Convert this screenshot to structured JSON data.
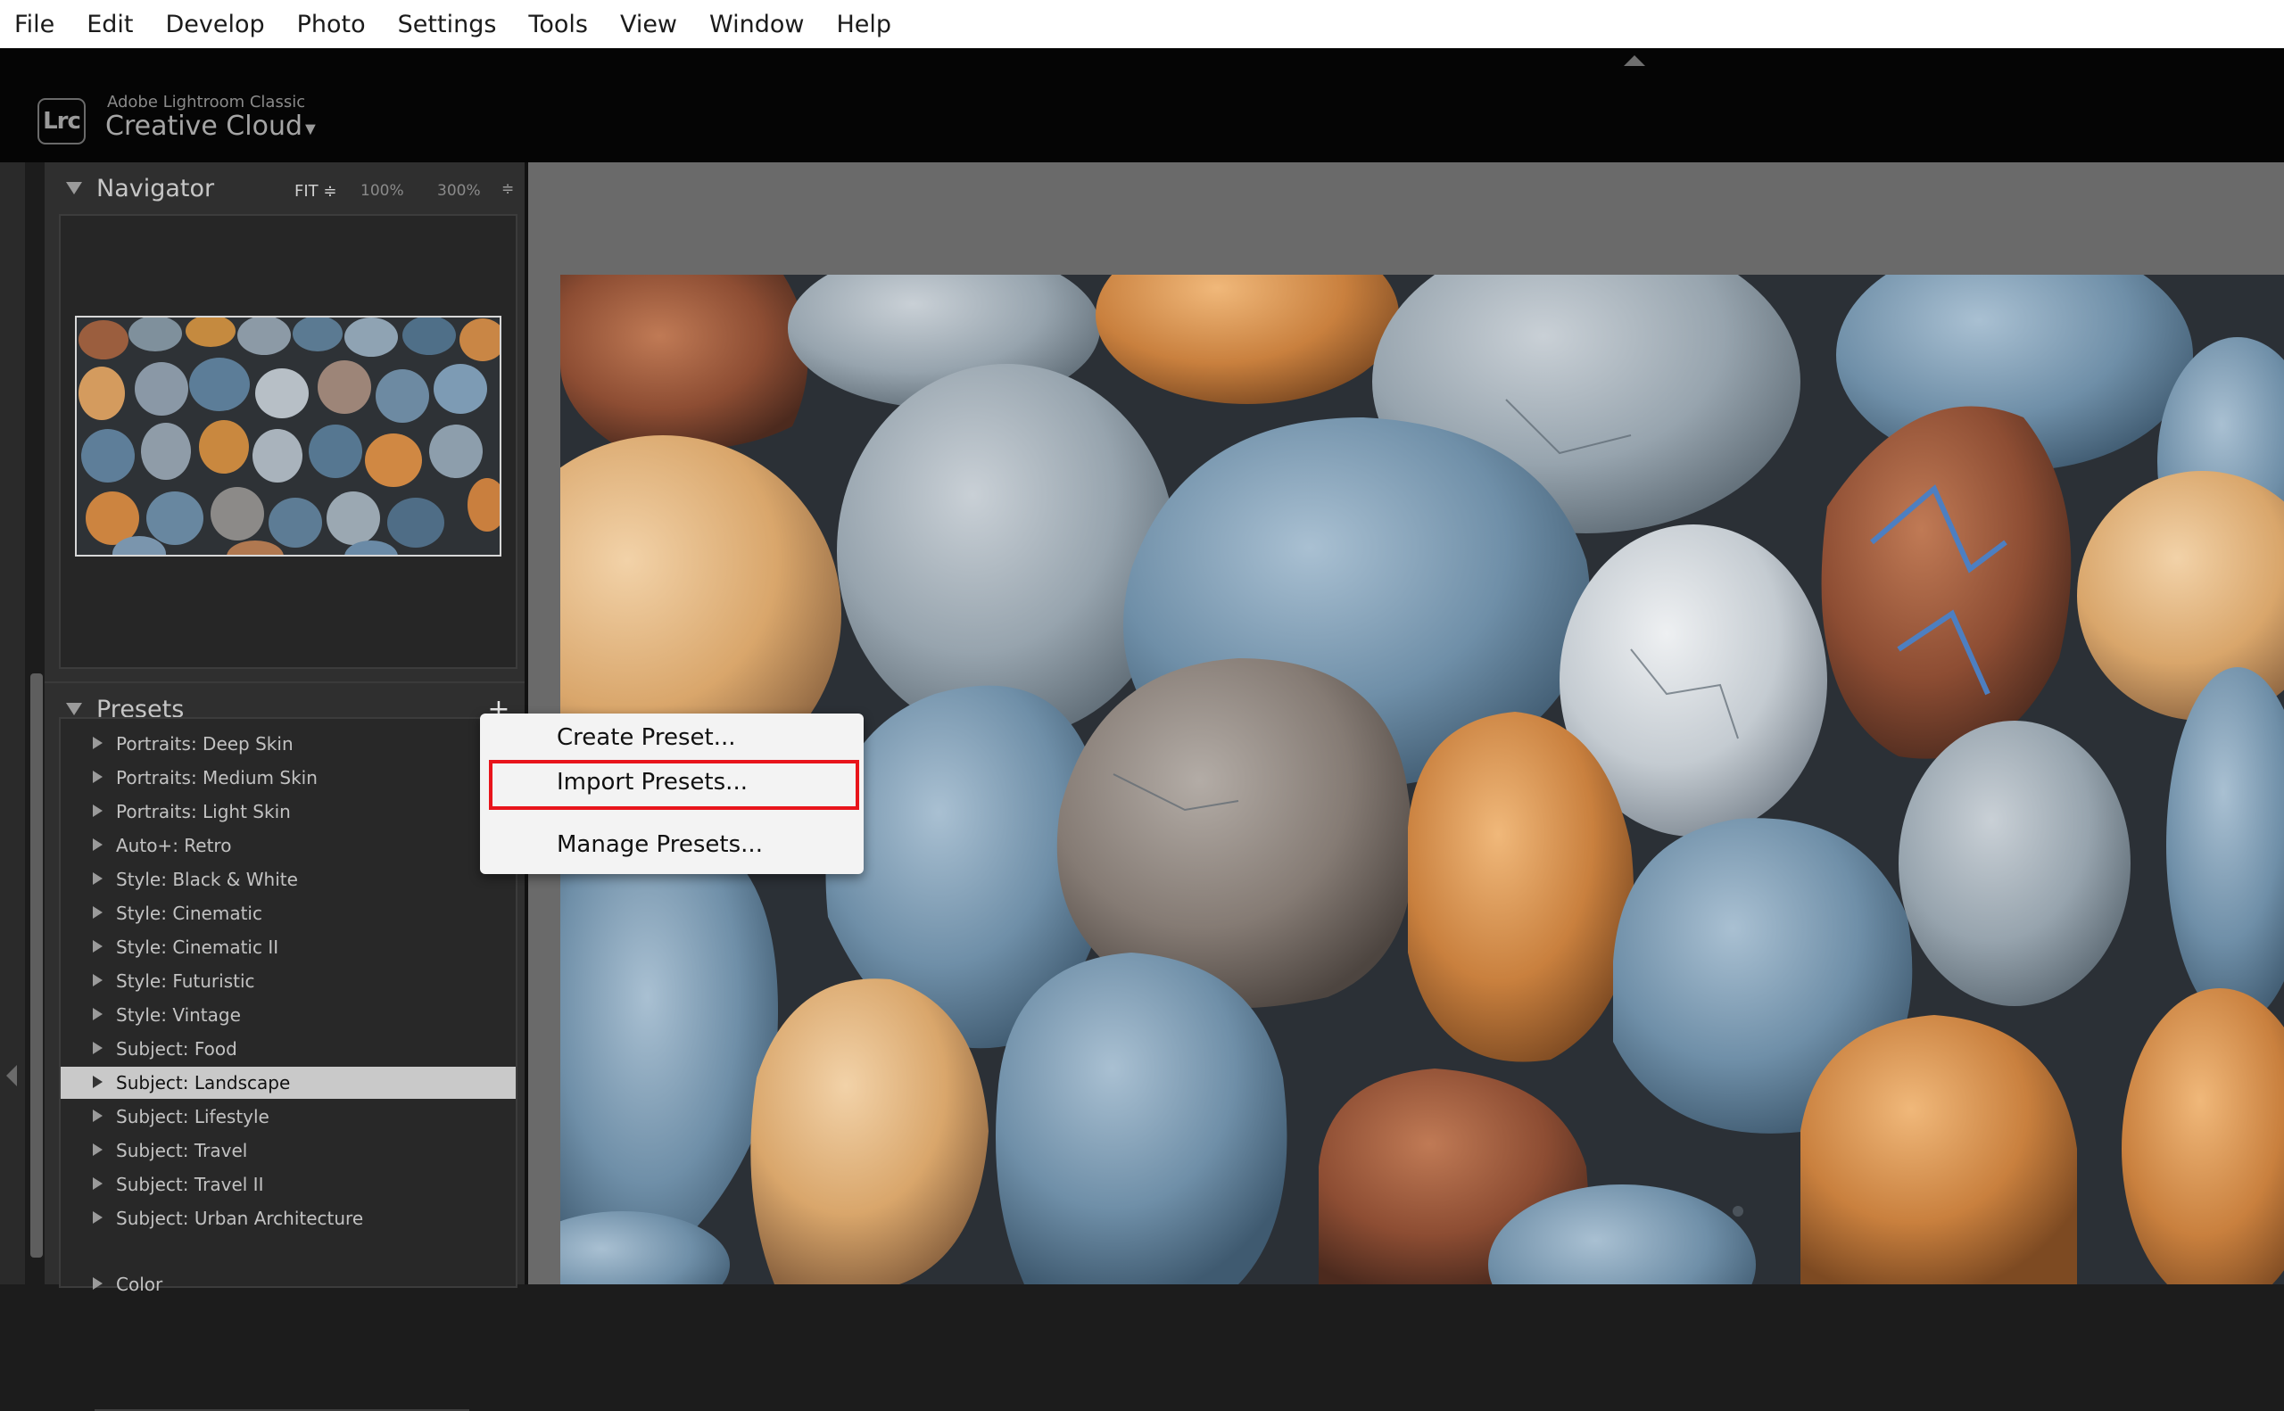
{
  "menubar": {
    "items": [
      "File",
      "Edit",
      "Develop",
      "Photo",
      "Settings",
      "Tools",
      "View",
      "Window",
      "Help"
    ]
  },
  "identity": {
    "logo_text": "Lrc",
    "app_name": "Adobe Lightroom Classic",
    "plate": "Creative Cloud",
    "dropdown_arrow": "▼"
  },
  "navigator": {
    "title": "Navigator",
    "zoom_fit": "FIT ≑",
    "zoom_100": "100%",
    "zoom_300": "300%",
    "zoom_arrows": "≑"
  },
  "presets": {
    "title": "Presets",
    "add_symbol": "+",
    "items": [
      "Portraits: Deep Skin",
      "Portraits: Medium Skin",
      "Portraits: Light Skin",
      "Auto+: Retro",
      "Style: Black & White",
      "Style: Cinematic",
      "Style: Cinematic II",
      "Style: Futuristic",
      "Style: Vintage",
      "Subject: Food",
      "Subject: Landscape",
      "Subject: Lifestyle",
      "Subject: Travel",
      "Subject: Travel II",
      "Subject: Urban Architecture"
    ],
    "selected_item": "Subject: Landscape",
    "next_group": "Color"
  },
  "context_menu": {
    "create": "Create Preset...",
    "import": "Import Presets...",
    "manage": "Manage Presets...",
    "highlighted": "Import Presets..."
  },
  "colors": {
    "highlight_border": "#e8141b",
    "selected_row": "#c9c9c9",
    "panel_bg": "#2f2f2f"
  },
  "icons": {
    "logo": "lightroom-classic-logo-icon",
    "collapse": "triangle-down-icon",
    "expand": "triangle-right-icon",
    "add": "plus-icon"
  }
}
